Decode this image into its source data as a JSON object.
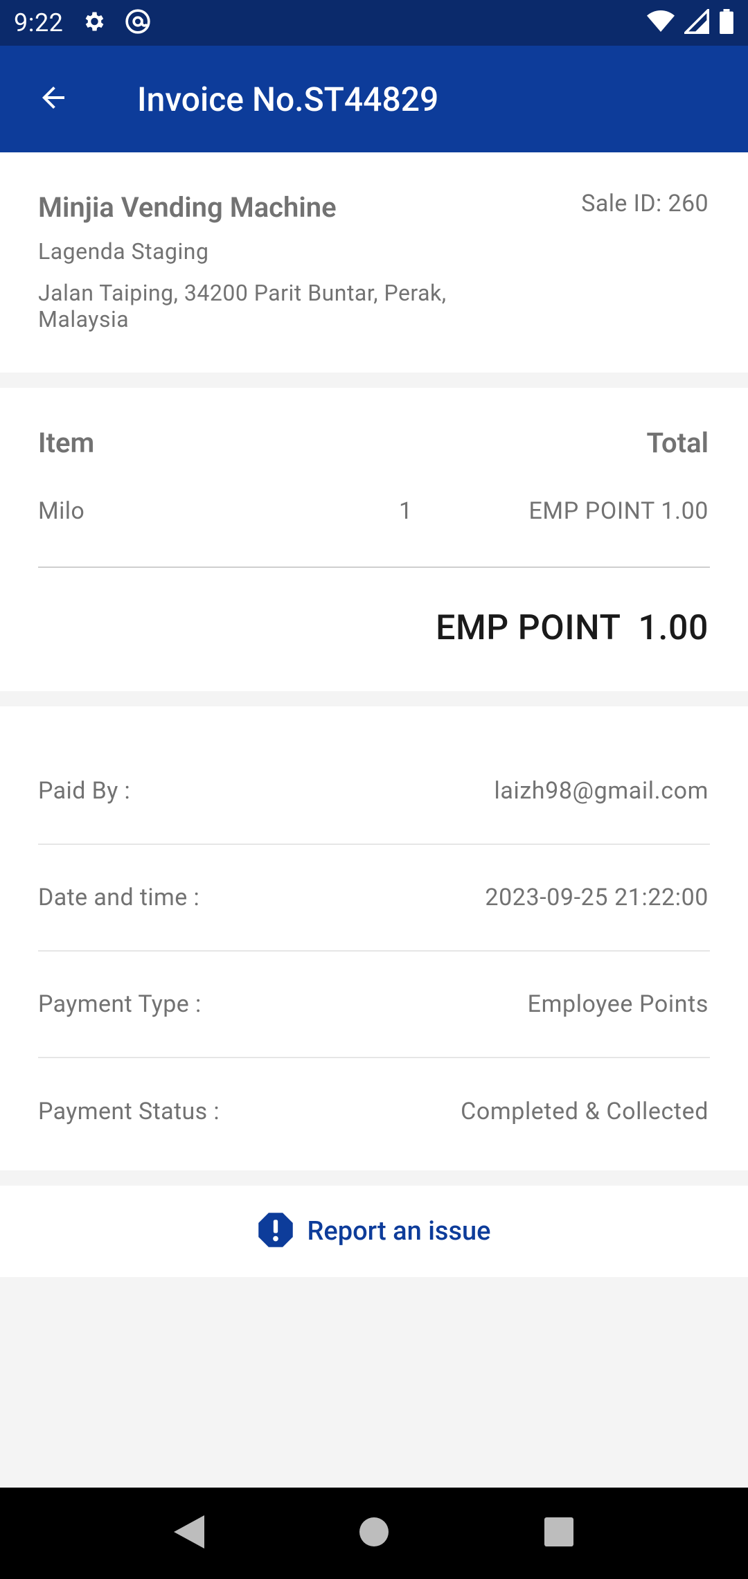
{
  "status_bar": {
    "time": "9:22"
  },
  "app_bar": {
    "title": "Invoice No.ST44829"
  },
  "merchant": {
    "name": "Minjia Vending Machine",
    "sale_id": "Sale ID: 260",
    "location": "Lagenda Staging",
    "address": "Jalan Taiping, 34200 Parit Buntar, Perak, Malaysia"
  },
  "items": {
    "header_item": "Item",
    "header_total": "Total",
    "rows": [
      {
        "name": "Milo",
        "qty": "1",
        "total": "EMP POINT 1.00"
      }
    ],
    "grand_total": "EMP POINT  1.00"
  },
  "details": [
    {
      "label": "Paid By :",
      "value": "laizh98@gmail.com"
    },
    {
      "label": "Date and time :",
      "value": "2023-09-25 21:22:00"
    },
    {
      "label": "Payment Type :",
      "value": "Employee Points"
    },
    {
      "label": "Payment Status :",
      "value": "Completed & Collected"
    }
  ],
  "report": {
    "label": "Report an issue"
  },
  "colors": {
    "status_bar": "#0b2a6b",
    "app_bar": "#0d3c9a",
    "accent": "#0d3c9a",
    "background": "#f4f4f4"
  }
}
